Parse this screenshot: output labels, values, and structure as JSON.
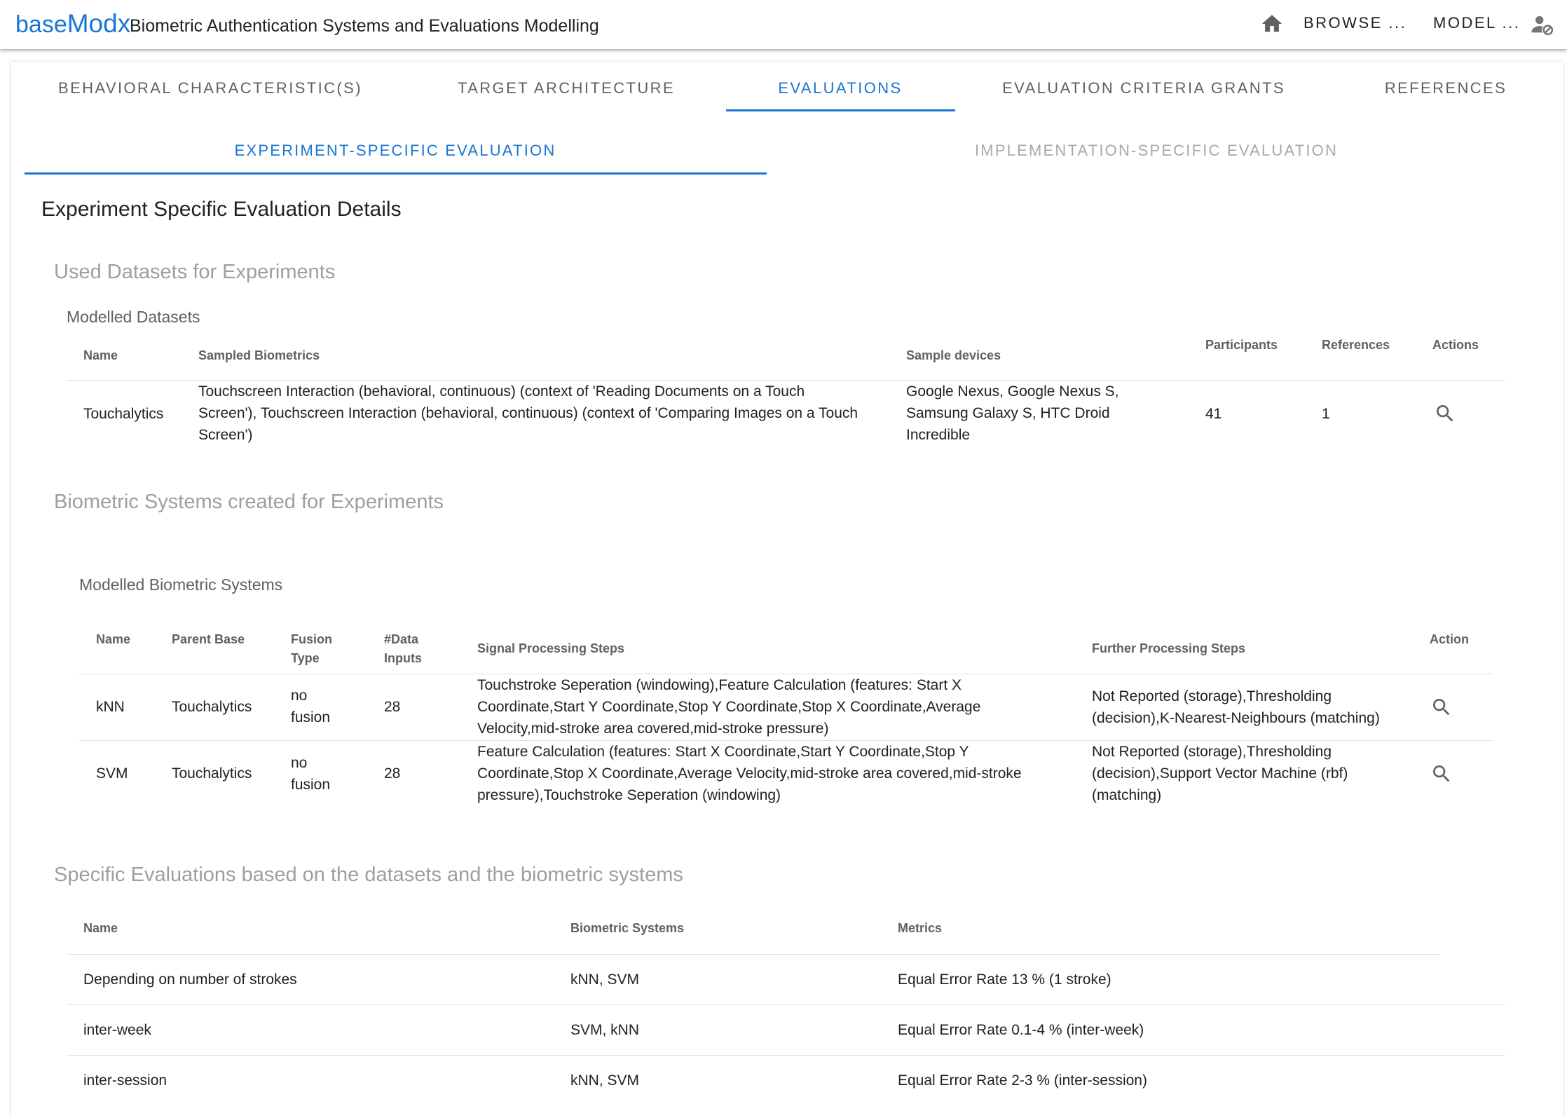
{
  "app": {
    "brand_prefix": "base",
    "brand_suffix": "Modx",
    "title": "Biometric Authentication Systems and Evaluations Modelling",
    "nav": {
      "home_icon": "home-icon",
      "browse_label": "BROWSE ...",
      "model_label": "MODEL ...",
      "user_icon": "user-settings-icon"
    },
    "accent_color": "#1976d2"
  },
  "tabs": [
    {
      "label": "BEHAVIORAL CHARACTERISTIC(S)"
    },
    {
      "label": "TARGET ARCHITECTURE"
    },
    {
      "label": "EVALUATIONS"
    },
    {
      "label": "EVALUATION CRITERIA GRANTS"
    },
    {
      "label": "REFERENCES"
    }
  ],
  "active_tab": "EVALUATIONS",
  "subtabs": [
    {
      "label": "EXPERIMENT-SPECIFIC EVALUATION"
    },
    {
      "label": "IMPLEMENTATION-SPECIFIC EVALUATION"
    }
  ],
  "active_subtab": "EXPERIMENT-SPECIFIC EVALUATION",
  "page_title": "Experiment Specific Evaluation Details",
  "datasets_section": {
    "heading": "Used Datasets for Experiments",
    "subheading": "Modelled Datasets",
    "columns": {
      "name": "Name",
      "sampled": "Sampled Biometrics",
      "devices": "Sample devices",
      "participants": "Participants",
      "references": "References",
      "actions": "Actions"
    },
    "rows": [
      {
        "name": "Touchalytics",
        "sampled_lines": [
          "Touchscreen Interaction (behavioral, continuous) (context of 'Reading Documents on a Touch",
          "Screen'), Touchscreen Interaction (behavioral, continuous) (context of 'Comparing Images on a Touch",
          "Screen')"
        ],
        "devices_lines": [
          "Google Nexus, Google Nexus S,",
          "Samsung Galaxy S, HTC Droid",
          "Incredible"
        ],
        "participants": "41",
        "references": "1",
        "action_icon": "search-icon"
      }
    ]
  },
  "systems_section": {
    "heading": "Biometric Systems created for Experiments",
    "subheading": "Modelled Biometric Systems",
    "columns": {
      "name": "Name",
      "parent": "Parent Base",
      "fusion_lines": [
        "Fusion",
        "Type"
      ],
      "inputs_lines": [
        "#Data",
        "Inputs"
      ],
      "signal": "Signal Processing Steps",
      "further": "Further Processing Steps",
      "action": "Action"
    },
    "rows": [
      {
        "name": "kNN",
        "parent": "Touchalytics",
        "fusion_lines": [
          "no",
          "fusion"
        ],
        "inputs": "28",
        "signal_lines": [
          "Touchstroke Seperation (windowing),Feature Calculation (features: Start X",
          "Coordinate,Start Y Coordinate,Stop Y Coordinate,Stop X Coordinate,Average",
          "Velocity,mid-stroke area covered,mid-stroke pressure)"
        ],
        "further_lines": [
          "Not Reported (storage),Thresholding",
          "(decision),K-Nearest-Neighbours (matching)"
        ],
        "action_icon": "search-icon"
      },
      {
        "name": "SVM",
        "parent": "Touchalytics",
        "fusion_lines": [
          "no",
          "fusion"
        ],
        "inputs": "28",
        "signal_lines": [
          "Feature Calculation (features: Start X Coordinate,Start Y Coordinate,Stop Y",
          "Coordinate,Stop X Coordinate,Average Velocity,mid-stroke area covered,mid-stroke",
          "pressure),Touchstroke Seperation (windowing)"
        ],
        "further_lines": [
          "Not Reported (storage),Thresholding",
          "(decision),Support Vector Machine (rbf)",
          "(matching)"
        ],
        "action_icon": "search-icon"
      }
    ]
  },
  "evaluations_section": {
    "heading": "Specific Evaluations based on the datasets and the biometric systems",
    "columns": {
      "name": "Name",
      "systems": "Biometric Systems",
      "metrics": "Metrics"
    },
    "rows": [
      {
        "name": "Depending on number of strokes",
        "systems": "kNN, SVM",
        "metrics": "Equal Error Rate 13 % (1 stroke)"
      },
      {
        "name": "inter-week",
        "systems": "SVM, kNN",
        "metrics": "Equal Error Rate 0.1-4 % (inter-week)"
      },
      {
        "name": "inter-session",
        "systems": "kNN, SVM",
        "metrics": "Equal Error Rate 2-3 % (inter-session)"
      }
    ]
  }
}
